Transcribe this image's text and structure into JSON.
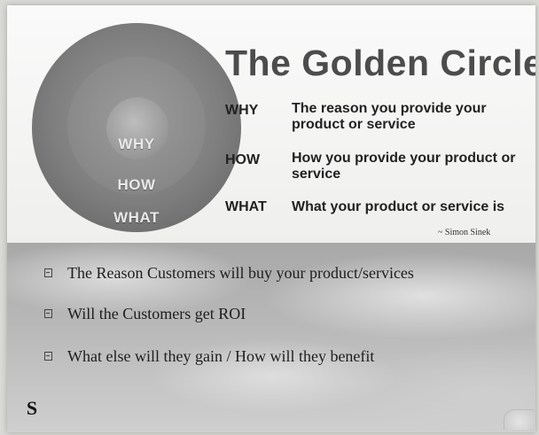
{
  "slide": {
    "title": "The Golden Circle",
    "circle": {
      "inner_label": "WHY",
      "middle_label": "HOW",
      "outer_label": "WHAT"
    },
    "definitions": [
      {
        "term": "WHY",
        "text": "The reason you provide your product or service"
      },
      {
        "term": "HOW",
        "text": "How you provide your product or service"
      },
      {
        "term": "WHAT",
        "text": "What your product or service is"
      }
    ],
    "attribution": "~ Simon Sinek",
    "bullets": [
      "The Reason Customers will buy your product/services",
      "Will the Customers get ROI",
      "What else will they gain / How will they benefit"
    ],
    "logo_icon": "company-logo-icon"
  }
}
